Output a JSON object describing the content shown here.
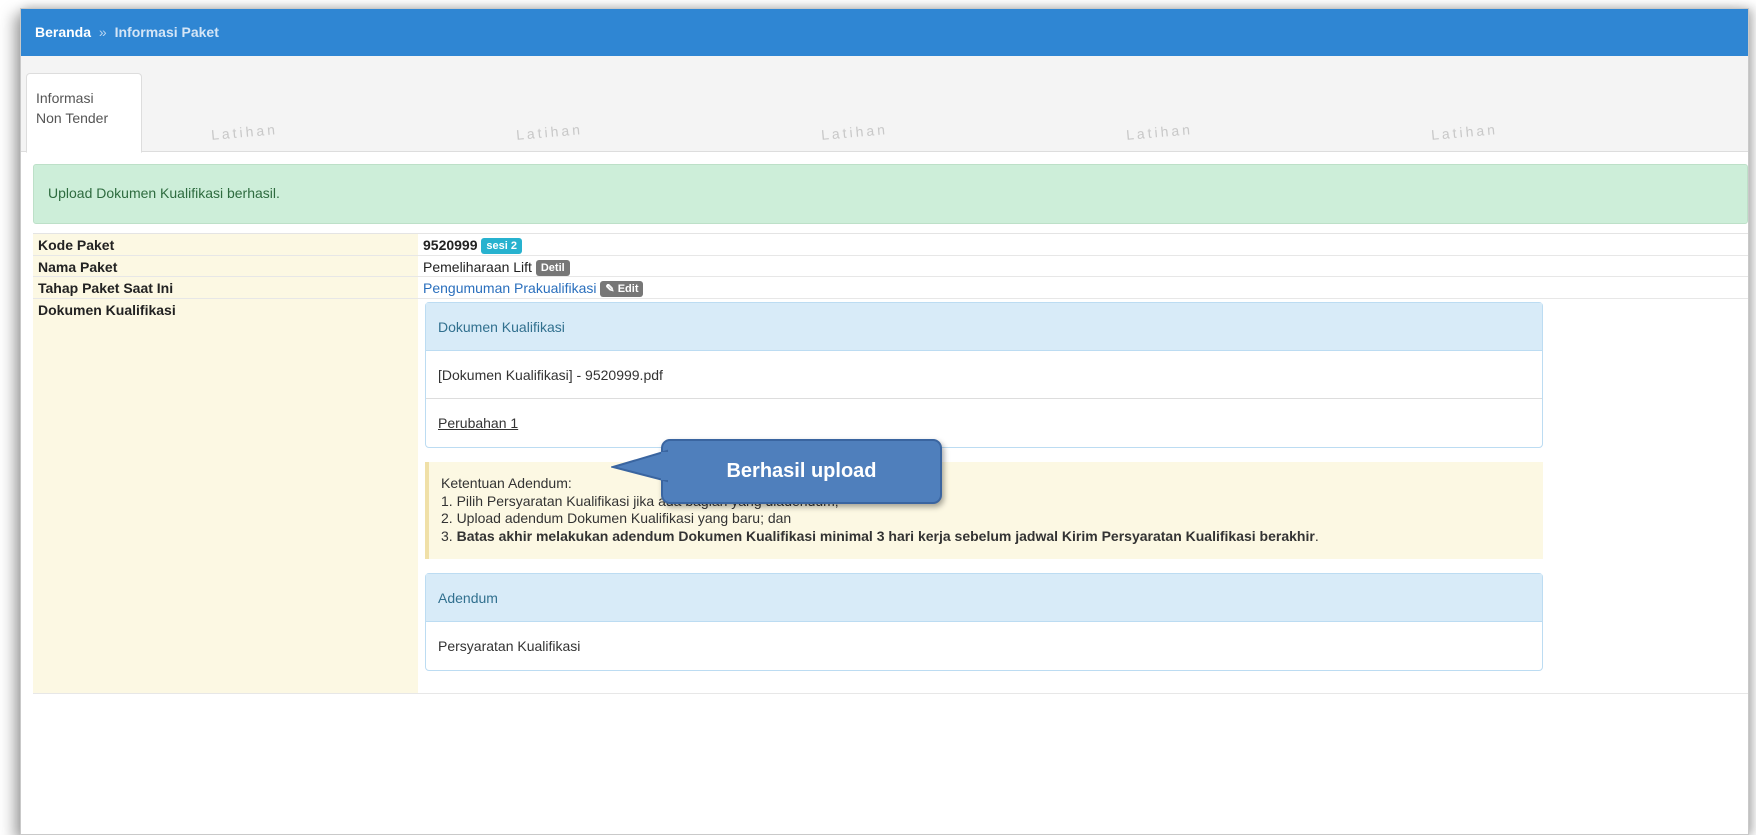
{
  "breadcrumb": {
    "home": "Beranda",
    "separator": "»",
    "current": "Informasi Paket"
  },
  "tabs": [
    {
      "label_line1": "Informasi",
      "label_line2": "Non Tender"
    }
  ],
  "watermark_text": "Latihan",
  "alert": {
    "message": "Upload Dokumen Kualifikasi berhasil."
  },
  "info": {
    "kode_paket": {
      "label": "Kode Paket",
      "value": "9520999",
      "badge": "sesi 2"
    },
    "nama_paket": {
      "label": "Nama Paket",
      "value": "Pemeliharaan Lift",
      "badge": "Detil"
    },
    "tahap_paket": {
      "label": "Tahap Paket Saat Ini",
      "value": "Pengumuman Prakualifikasi",
      "badge": "Edit"
    },
    "dokumen": {
      "label": "Dokumen Kualifikasi"
    }
  },
  "dokumen_panel": {
    "heading": "Dokumen Kualifikasi",
    "file": "[Dokumen Kualifikasi] - 9520999.pdf",
    "perubahan": "Perubahan 1"
  },
  "note": {
    "title": "Ketentuan Adendum:",
    "item1": "1. Pilih Persyaratan Kualifikasi jika ada bagian yang diadendum;",
    "item2": "2. Upload adendum Dokumen Kualifikasi yang baru; dan",
    "item3_prefix": "3. ",
    "item3_bold": "Batas akhir melakukan adendum Dokumen Kualifikasi minimal 3 hari kerja sebelum jadwal Kirim Persyaratan Kualifikasi berakhir",
    "item3_suffix": "."
  },
  "adendum_panel": {
    "heading": "Adendum",
    "item": "Persyaratan Kualifikasi"
  },
  "callout": {
    "text": "Berhasil upload"
  },
  "colors": {
    "topbar": "#2f86d3",
    "alert_bg": "#cdeed9",
    "label_bg": "#fcf8e3",
    "panel_heading": "#d8ebf8",
    "badge_cyan": "#27b2cf",
    "badge_grey": "#777777",
    "callout": "#4f7fbc"
  }
}
